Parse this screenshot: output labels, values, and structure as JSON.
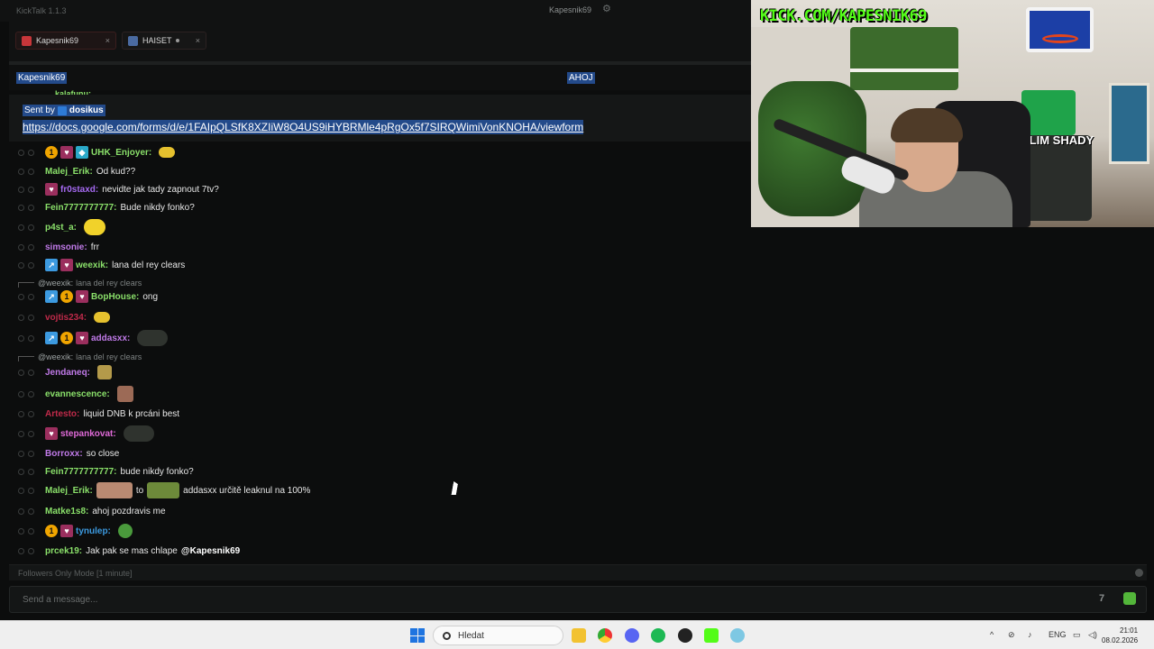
{
  "app": {
    "title": "KickTalk 1.1.3",
    "current_user": "Kapesnik69",
    "settings_icon": "gear-icon"
  },
  "tabs": [
    {
      "label": "Kapesnik69",
      "close": "×"
    },
    {
      "label": "HAISET",
      "close": "×"
    }
  ],
  "channel_header": {
    "name": "Kapesnik69",
    "greeting": "AHOJ"
  },
  "clipped_top_user": "kalafunu:",
  "pinned": {
    "sent_by_label": "Sent by",
    "sender": "dosikus",
    "link": "https://docs.google.com/forms/d/e/1FAIpQLSfK8XZIiW8O4US9iHYBRMle4pRgOx5f7SIRQWimiVonKNOHA/viewform"
  },
  "messages": [
    {
      "user": "UHK_Enjoyer:",
      "text": "",
      "color": "#8ae06a"
    },
    {
      "user": "Malej_Erik:",
      "text": "Od kud??",
      "color": "#8ae06a"
    },
    {
      "user": "fr0staxd:",
      "text": "nevidte jak tady zapnout 7tv?",
      "color": "#a66af2"
    },
    {
      "user": "Fein7777777777:",
      "text": "Bude nikdy fonko?",
      "color": "#8ae06a"
    },
    {
      "user": "p4st_a:",
      "text": "",
      "color": "#8ae06a"
    },
    {
      "user": "simsonie:",
      "text": "frr",
      "color": "#c07ae8"
    },
    {
      "user": "weexik:",
      "text": "lana del rey clears",
      "color": "#8ae06a"
    },
    {
      "user": "BopHouse:",
      "text": "ong",
      "color": "#8ae06a"
    },
    {
      "user": "vojtis234:",
      "text": "",
      "color": "#c02a4a"
    },
    {
      "user": "addasxx:",
      "text": "",
      "color": "#c07ae8"
    },
    {
      "user": "Jendaneq:",
      "text": "",
      "color": "#c07ae8"
    },
    {
      "user": "evannescence:",
      "text": "",
      "color": "#8ae06a"
    },
    {
      "user": "Artesto:",
      "text": "liquid DNB k prcáni best",
      "color": "#c02a4a"
    },
    {
      "user": "stepankovat:",
      "text": "",
      "color": "#e06ad8"
    },
    {
      "user": "Borroxx:",
      "text": "so close",
      "color": "#c07ae8"
    },
    {
      "user": "Fein7777777777:",
      "text": "bude nikdy fonko?",
      "color": "#8ae06a"
    },
    {
      "user": "Malej_Erik:",
      "text": "addasxx určitě leaknul na 100%",
      "to": "to",
      "color": "#8ae06a"
    },
    {
      "user": "Matke1s8:",
      "text": "ahoj pozdravis me",
      "color": "#8ae06a"
    },
    {
      "user": "tynulep:",
      "text": "",
      "color": "#3c9ae0"
    },
    {
      "user": "prcek19:",
      "text": "Jak pak se mas chlape",
      "mention": "@Kapesnik69",
      "color": "#8ae06a"
    }
  ],
  "replies": [
    {
      "who": "@weexik:",
      "text": "lana del rey clears"
    },
    {
      "who": "@weexik:",
      "text": "lana del rey clears"
    }
  ],
  "badges": {
    "num": "1"
  },
  "status": {
    "followers_only": "Followers Only Mode [1 minute]"
  },
  "input": {
    "placeholder": "Send a message..."
  },
  "stream": {
    "overlay_text": "KICK.COM/KAPESNIK69",
    "poster_text": "SLIM SHADY"
  },
  "taskbar": {
    "search_placeholder": "Hledat",
    "language": "ENG",
    "time": "21:01",
    "date": "08.02.2026"
  }
}
